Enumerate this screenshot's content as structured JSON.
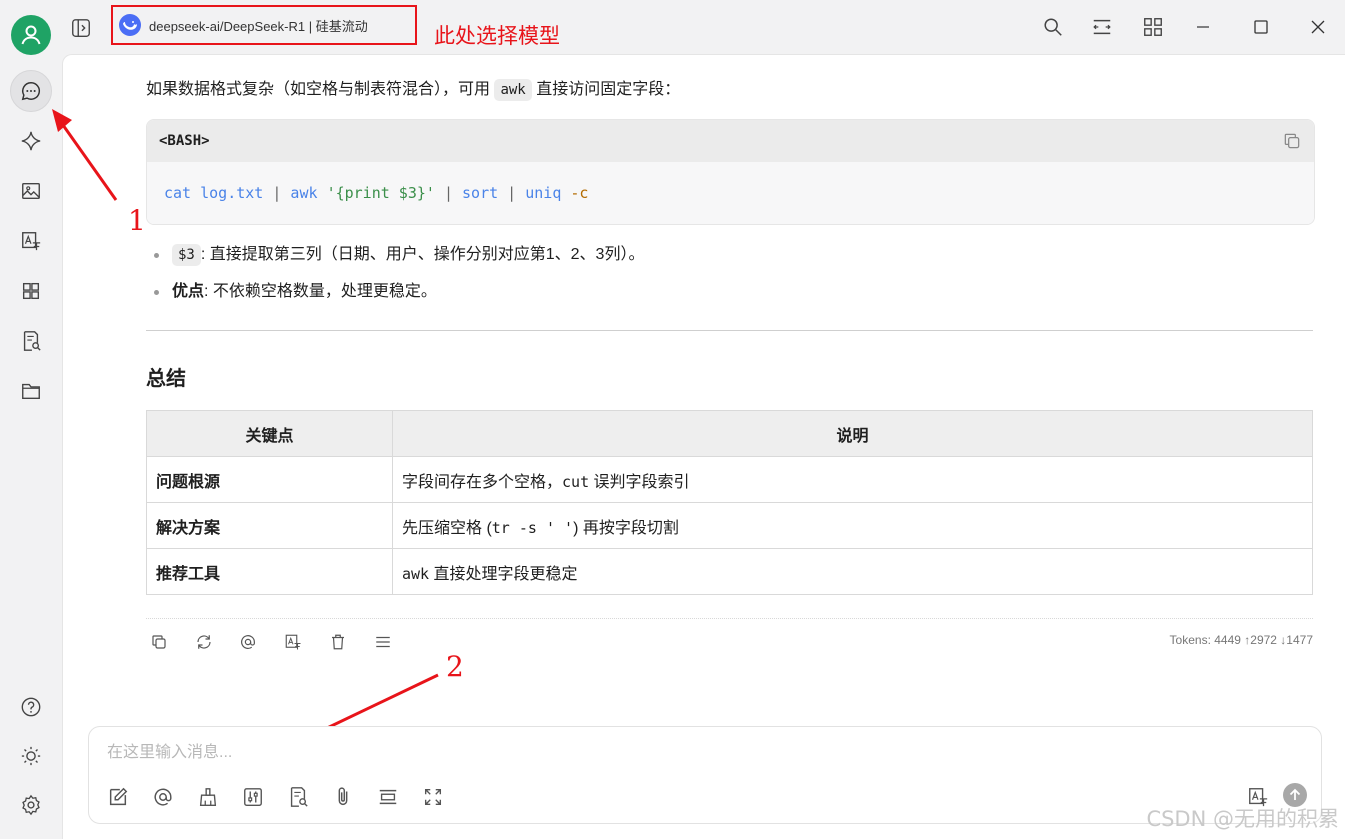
{
  "topbar": {
    "model_name": "deepseek-ai/DeepSeek-R1 | 硅基流动",
    "annotation": "此处选择模型"
  },
  "message": {
    "intro_before": "如果数据格式复杂（如空格与制表符混合），可用 ",
    "intro_code": "awk",
    "intro_after": " 直接访问固定字段：",
    "code_lang": "<BASH>",
    "code": {
      "t1": "cat",
      "t2": " log.txt ",
      "t3": "|",
      "t4": " awk ",
      "t5": "'{print $3}'",
      "t6": " | ",
      "t7": "sort",
      "t8": " | ",
      "t9": "uniq",
      "t10": " -c"
    },
    "bullets": [
      {
        "code": "$3",
        "text": ": 直接提取第三列（日期、用户、操作分别对应第1、2、3列）。"
      },
      {
        "bold": "优点",
        "text": ": 不依赖空格数量，处理更稳定。"
      }
    ],
    "summary_title": "总结",
    "table": {
      "headers": [
        "关键点",
        "说明"
      ],
      "rows": [
        {
          "key": "问题根源",
          "pre": "字段间存在多个空格，",
          "code": "cut",
          "post": " 误判字段索引"
        },
        {
          "key": "解决方案",
          "pre": "先压缩空格 (",
          "code": "tr -s ' '",
          "post": ") 再按字段切割"
        },
        {
          "key": "推荐工具",
          "pre": "",
          "code": "awk",
          "post": " 直接处理字段更稳定"
        }
      ]
    },
    "tokens": "Tokens: 4449 ↑2972 ↓1477"
  },
  "annotations": {
    "one": "1",
    "two": "2"
  },
  "input": {
    "placeholder": "在这里输入消息..."
  },
  "watermark": "CSDN @无用的积累",
  "colors": {
    "accent": "#1fa365",
    "annotation": "#e8141a"
  }
}
